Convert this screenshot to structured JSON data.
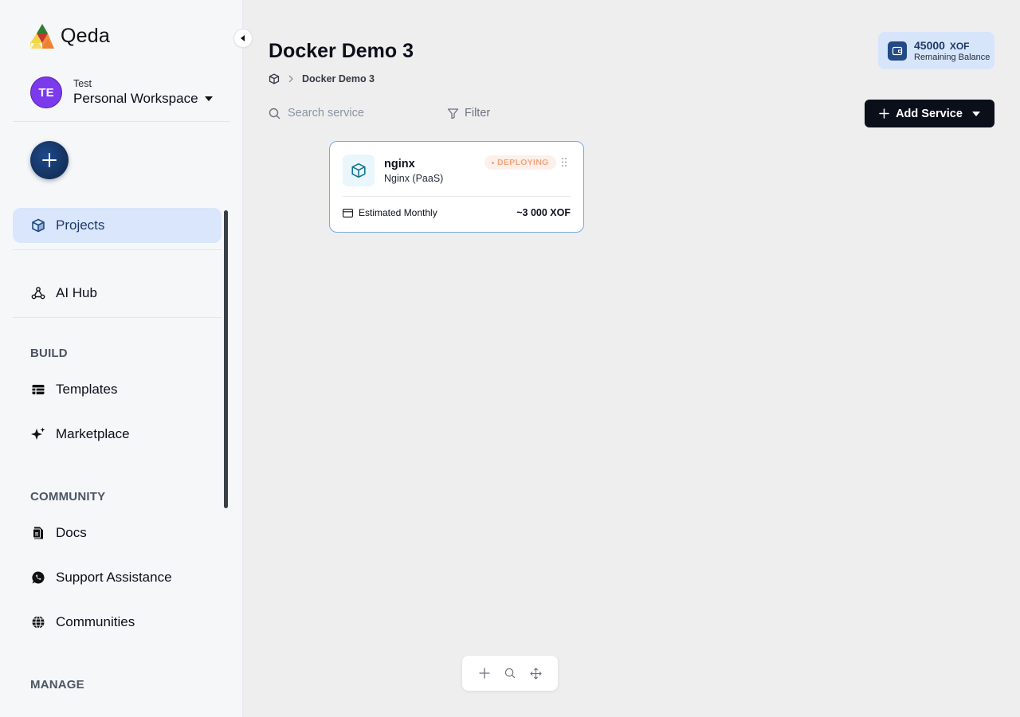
{
  "brand": {
    "name": "Qeda"
  },
  "workspace": {
    "label": "Test",
    "name": "Personal Workspace",
    "initials": "TE"
  },
  "sidebar": {
    "nav": [
      {
        "label": "Projects",
        "icon": "cube-icon",
        "active": true
      },
      {
        "label": "AI Hub",
        "icon": "webhook-icon",
        "active": false
      }
    ],
    "sections": [
      {
        "title": "BUILD",
        "items": [
          {
            "label": "Templates",
            "icon": "table-icon"
          },
          {
            "label": "Marketplace",
            "icon": "sparkles-icon"
          }
        ]
      },
      {
        "title": "COMMUNITY",
        "items": [
          {
            "label": "Docs",
            "icon": "document-icon"
          },
          {
            "label": "Support Assistance",
            "icon": "whatsapp-icon"
          },
          {
            "label": "Communities",
            "icon": "globe-icon"
          }
        ]
      },
      {
        "title": "MANAGE",
        "items": []
      }
    ]
  },
  "header": {
    "title": "Docker Demo 3",
    "breadcrumb": {
      "current": "Docker Demo 3"
    }
  },
  "balance": {
    "amount": "45000",
    "currency": "XOF",
    "label": "Remaining Balance"
  },
  "toolbar": {
    "search_placeholder": "Search service",
    "filter_label": "Filter",
    "add_service_label": "Add Service"
  },
  "service_card": {
    "name": "nginx",
    "type": "Nginx (PaaS)",
    "status": "DEPLOYING",
    "estimate_label": "Estimated Monthly",
    "estimate_value": "~3 000 XOF"
  },
  "colors": {
    "accent": "#214a86",
    "active_bg": "#d9e6fb",
    "status_deploying": "#f5a57f",
    "avatar": "#7c3aed"
  }
}
